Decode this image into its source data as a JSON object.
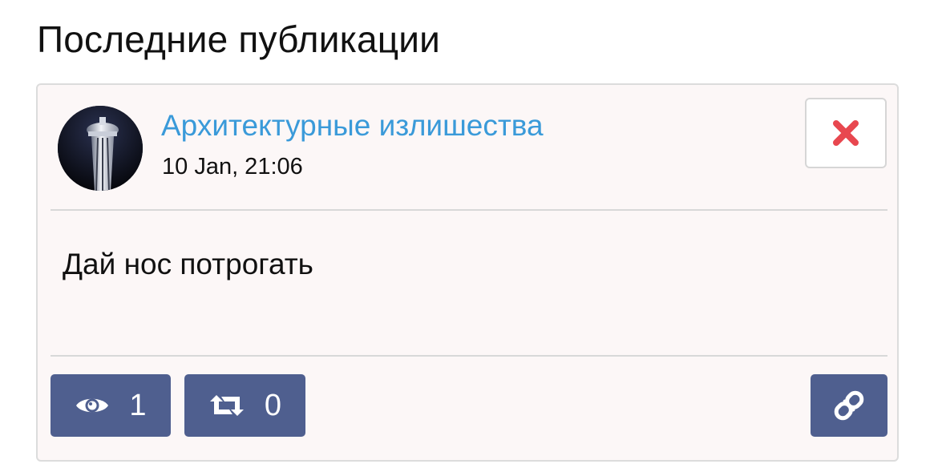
{
  "section": {
    "title": "Последние публикации"
  },
  "post": {
    "channel_name": "Архитектурные излишества",
    "date": "10 Jan, 21:06",
    "text": "Дай нос потрогать",
    "views_count": "1",
    "reposts_count": "0"
  },
  "icons": {
    "close": "close-icon",
    "views": "eye-icon",
    "reposts": "retweet-icon",
    "link": "link-icon"
  },
  "colors": {
    "accent_link": "#3a9ad9",
    "button_bg": "#4f5f8f",
    "close_icon": "#e8474f",
    "card_bg": "#fcf7f7"
  }
}
